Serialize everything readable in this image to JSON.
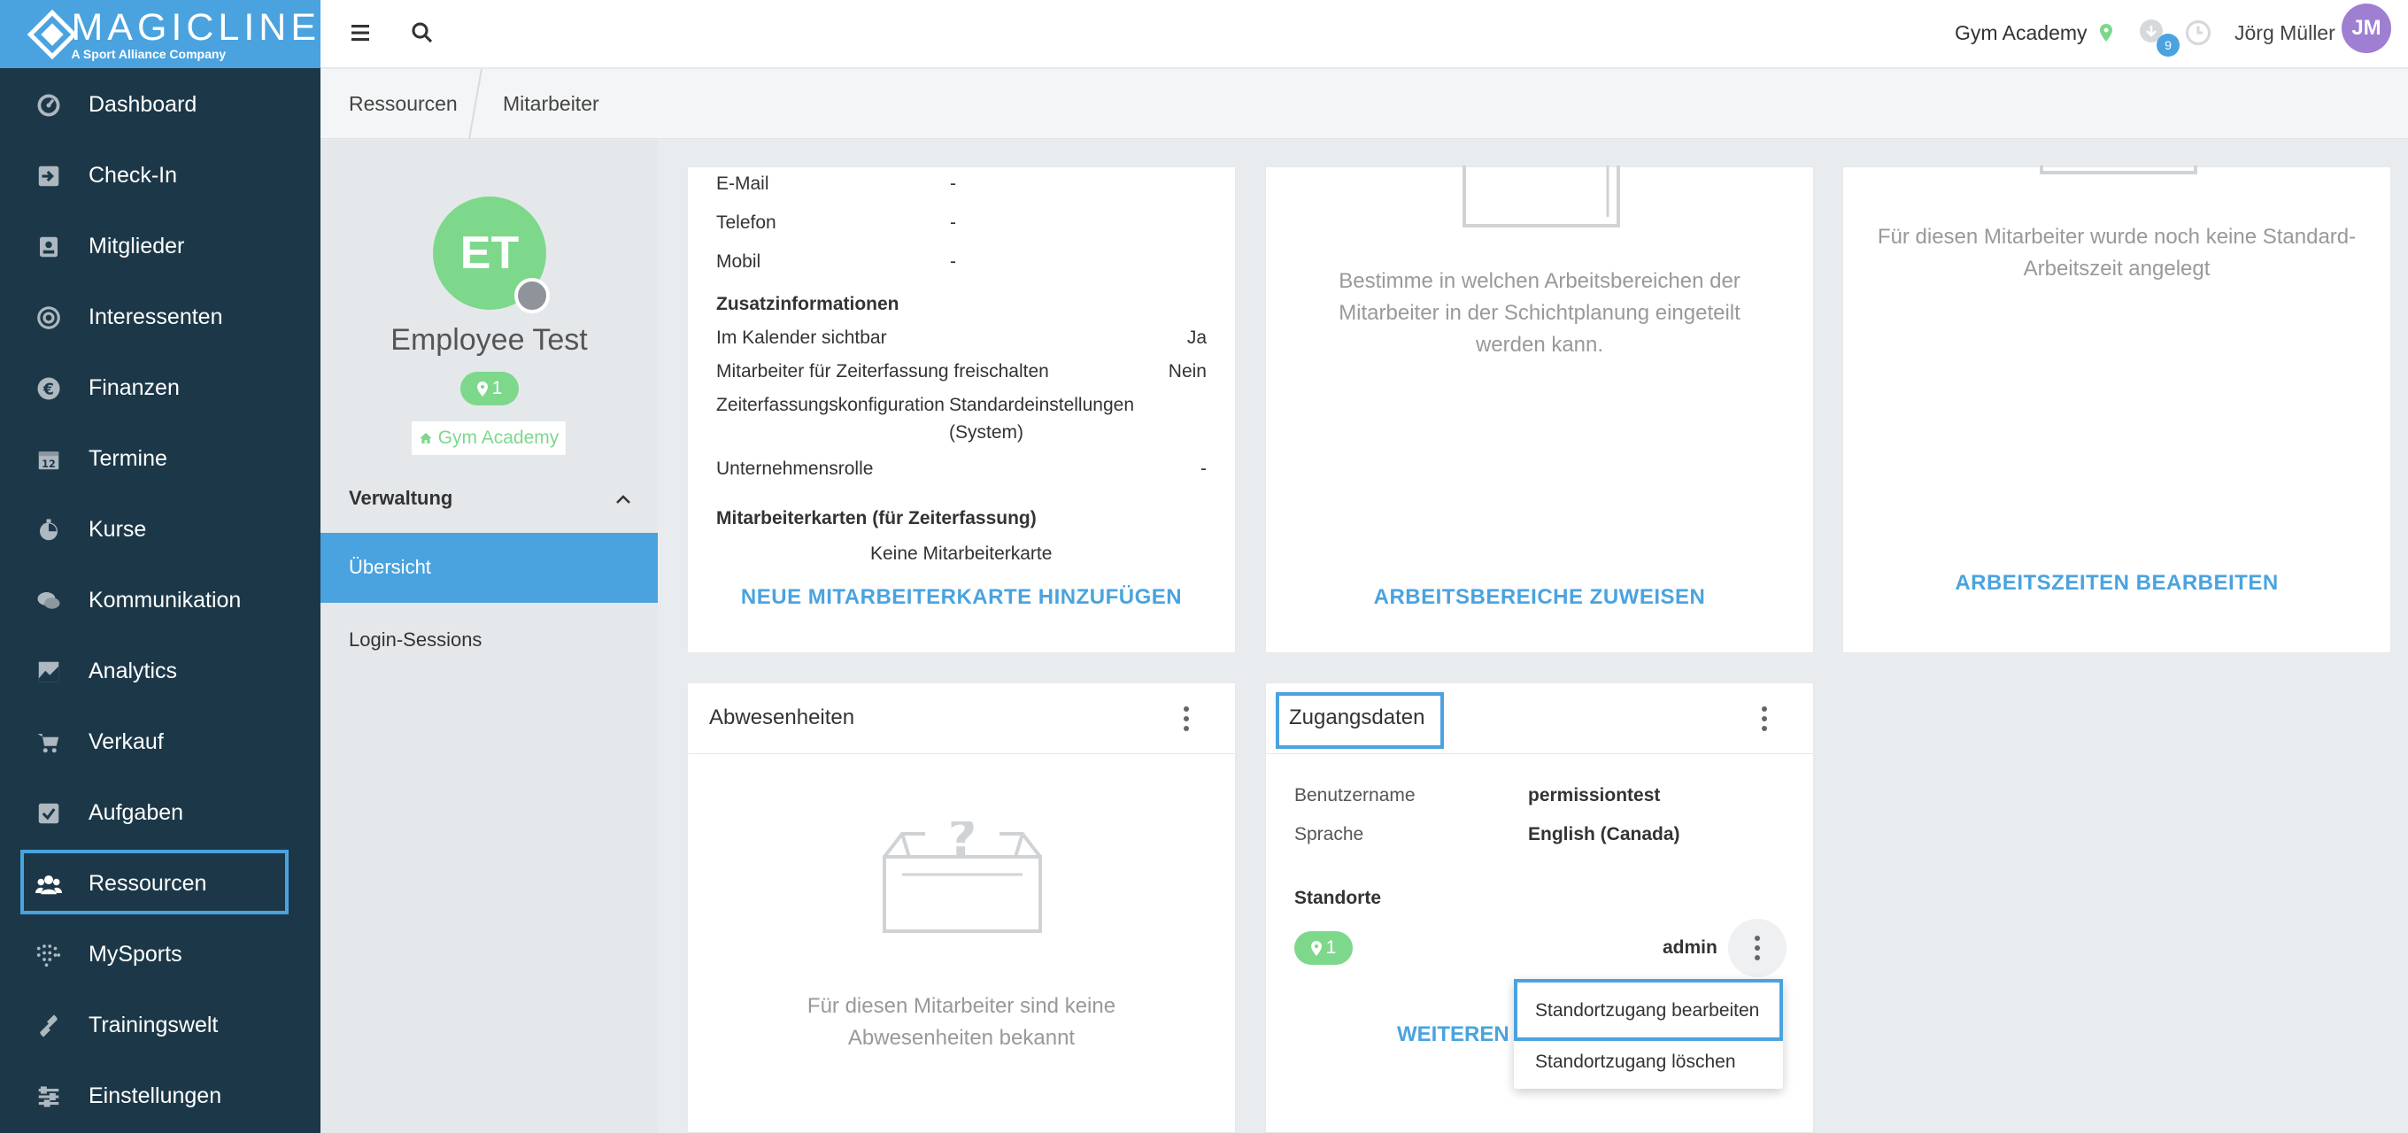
{
  "brand": {
    "name": "MAGICLINE",
    "tagline": "A Sport Alliance Company",
    "accent": "#4aa3df",
    "sidebar_bg": "#1c3848",
    "green": "#7dd88c"
  },
  "sidebar": {
    "items": [
      {
        "label": "Dashboard",
        "icon": "dashboard-icon"
      },
      {
        "label": "Check-In",
        "icon": "check-in-icon"
      },
      {
        "label": "Mitglieder",
        "icon": "members-icon"
      },
      {
        "label": "Interessenten",
        "icon": "prospects-icon"
      },
      {
        "label": "Finanzen",
        "icon": "euro-icon"
      },
      {
        "label": "Termine",
        "icon": "calendar-icon"
      },
      {
        "label": "Kurse",
        "icon": "courses-icon"
      },
      {
        "label": "Kommunikation",
        "icon": "chat-icon"
      },
      {
        "label": "Analytics",
        "icon": "chart-icon"
      },
      {
        "label": "Verkauf",
        "icon": "cart-icon"
      },
      {
        "label": "Aufgaben",
        "icon": "checkbox-icon"
      },
      {
        "label": "Ressourcen",
        "icon": "users-icon"
      },
      {
        "label": "MySports",
        "icon": "dots-grid-icon"
      },
      {
        "label": "Trainingswelt",
        "icon": "dumbbell-icon"
      },
      {
        "label": "Einstellungen",
        "icon": "sliders-icon"
      }
    ]
  },
  "header": {
    "gym": "Gym Academy",
    "notifications": "9",
    "user_name": "Jörg Müller",
    "user_initials": "JM"
  },
  "breadcrumb": {
    "items": [
      "Ressourcen",
      "Mitarbeiter"
    ]
  },
  "profile": {
    "initials": "ET",
    "name": "Employee Test",
    "locations_count": "1",
    "gym_tag": "Gym Academy"
  },
  "leftnav": {
    "section": "Verwaltung",
    "items": [
      "Übersicht",
      "Login-Sessions"
    ]
  },
  "contact_card": {
    "rows": [
      {
        "label": "E-Mail",
        "value": "-"
      },
      {
        "label": "Telefon",
        "value": "-"
      },
      {
        "label": "Mobil",
        "value": "-"
      }
    ],
    "extra_title": "Zusatzinformationen",
    "extra": [
      {
        "label": "Im Kalender sichtbar",
        "value": "Ja"
      },
      {
        "label": "Mitarbeiter für Zeiterfassung freischalten",
        "value": "Nein"
      },
      {
        "label": "Zeiterfassungskonfiguration",
        "value_line1": "Standardeinstellungen",
        "value_line2": "(System)"
      },
      {
        "label": "Unternehmensrolle",
        "value": "-"
      }
    ],
    "cards_title": "Mitarbeiterkarten (für Zeiterfassung)",
    "cards_empty": "Keine Mitarbeiterkarte",
    "action": "NEUE MITARBEITERKARTE HINZUFÜGEN"
  },
  "areas_card": {
    "text_l1": "Bestimme in welchen Arbeitsbereichen der",
    "text_l2": "Mitarbeiter in der Schichtplanung eingeteilt",
    "text_l3": "werden kann.",
    "action": "ARBEITSBEREICHE ZUWEISEN"
  },
  "hours_card": {
    "text_l1": "Für diesen Mitarbeiter wurde noch keine Standard-",
    "text_l2": "Arbeitszeit angelegt",
    "action": "ARBEITSZEITEN BEARBEITEN"
  },
  "absence_card": {
    "title": "Abwesenheiten",
    "empty_l1": "Für diesen Mitarbeiter sind keine",
    "empty_l2": "Abwesenheiten bekannt"
  },
  "access_card": {
    "title": "Zugangsdaten",
    "username_label": "Benutzername",
    "username": "permissiontest",
    "language_label": "Sprache",
    "language": "English (Canada)",
    "locations_label": "Standorte",
    "locations_count": "1",
    "role": "admin",
    "action_partial": "WEITEREN Z"
  },
  "dropdown": {
    "items": [
      "Standortzugang bearbeiten",
      "Standortzugang löschen"
    ]
  }
}
